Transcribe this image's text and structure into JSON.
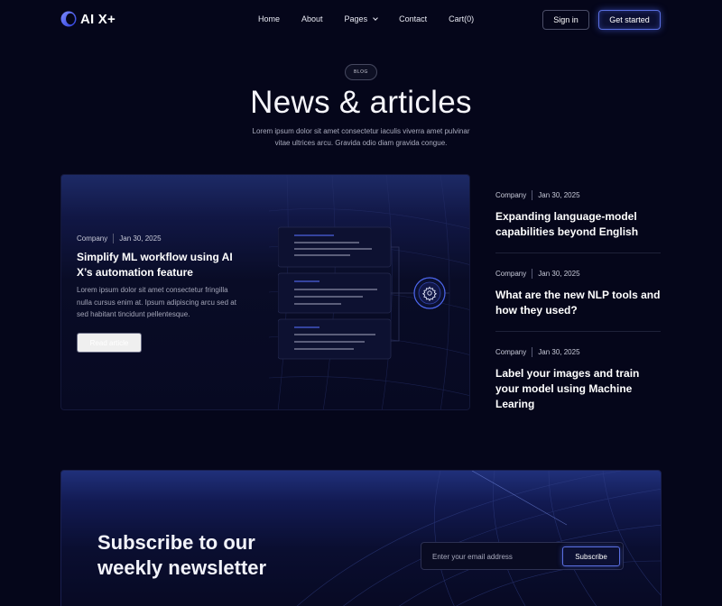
{
  "brand": {
    "name": "AI X+"
  },
  "nav": {
    "links": [
      {
        "label": "Home"
      },
      {
        "label": "About"
      },
      {
        "label": "Pages",
        "has_dropdown": true
      },
      {
        "label": "Contact"
      },
      {
        "label": "Cart(0)"
      }
    ],
    "signin_label": "Sign in",
    "get_started_label": "Get started"
  },
  "hero": {
    "badge": "BLOG",
    "title": "News & articles",
    "subtitle": "Lorem ipsum dolor sit amet consectetur iaculis viverra amet pulvinar vitae ultrices arcu. Gravida odio diam gravida congue."
  },
  "featured": {
    "category": "Company",
    "date": "Jan 30, 2025",
    "title": "Simplify ML workflow using AI X’s automation feature",
    "description": "Lorem ipsum dolor sit amet consectetur fringilla nulla cursus enim at. Ipsum adipiscing arcu sed at sed habitant tincidunt pellentesque.",
    "cta_label": "Read article",
    "icon": "gear-icon"
  },
  "side_articles": [
    {
      "category": "Company",
      "date": "Jan 30, 2025",
      "title": "Expanding language-model capabilities beyond English"
    },
    {
      "category": "Company",
      "date": "Jan 30, 2025",
      "title": "What are the new NLP tools and how they used?"
    },
    {
      "category": "Company",
      "date": "Jan 30, 2025",
      "title": "Label your images and train your model using Machine Learing"
    }
  ],
  "newsletter": {
    "title": "Subscribe to our weekly newsletter",
    "email_placeholder": "Enter your email address",
    "subscribe_label": "Subscribe"
  },
  "colors": {
    "background": "#05061a",
    "accent": "#5a6fe0",
    "card_gradient_top": "#1d2a66"
  }
}
